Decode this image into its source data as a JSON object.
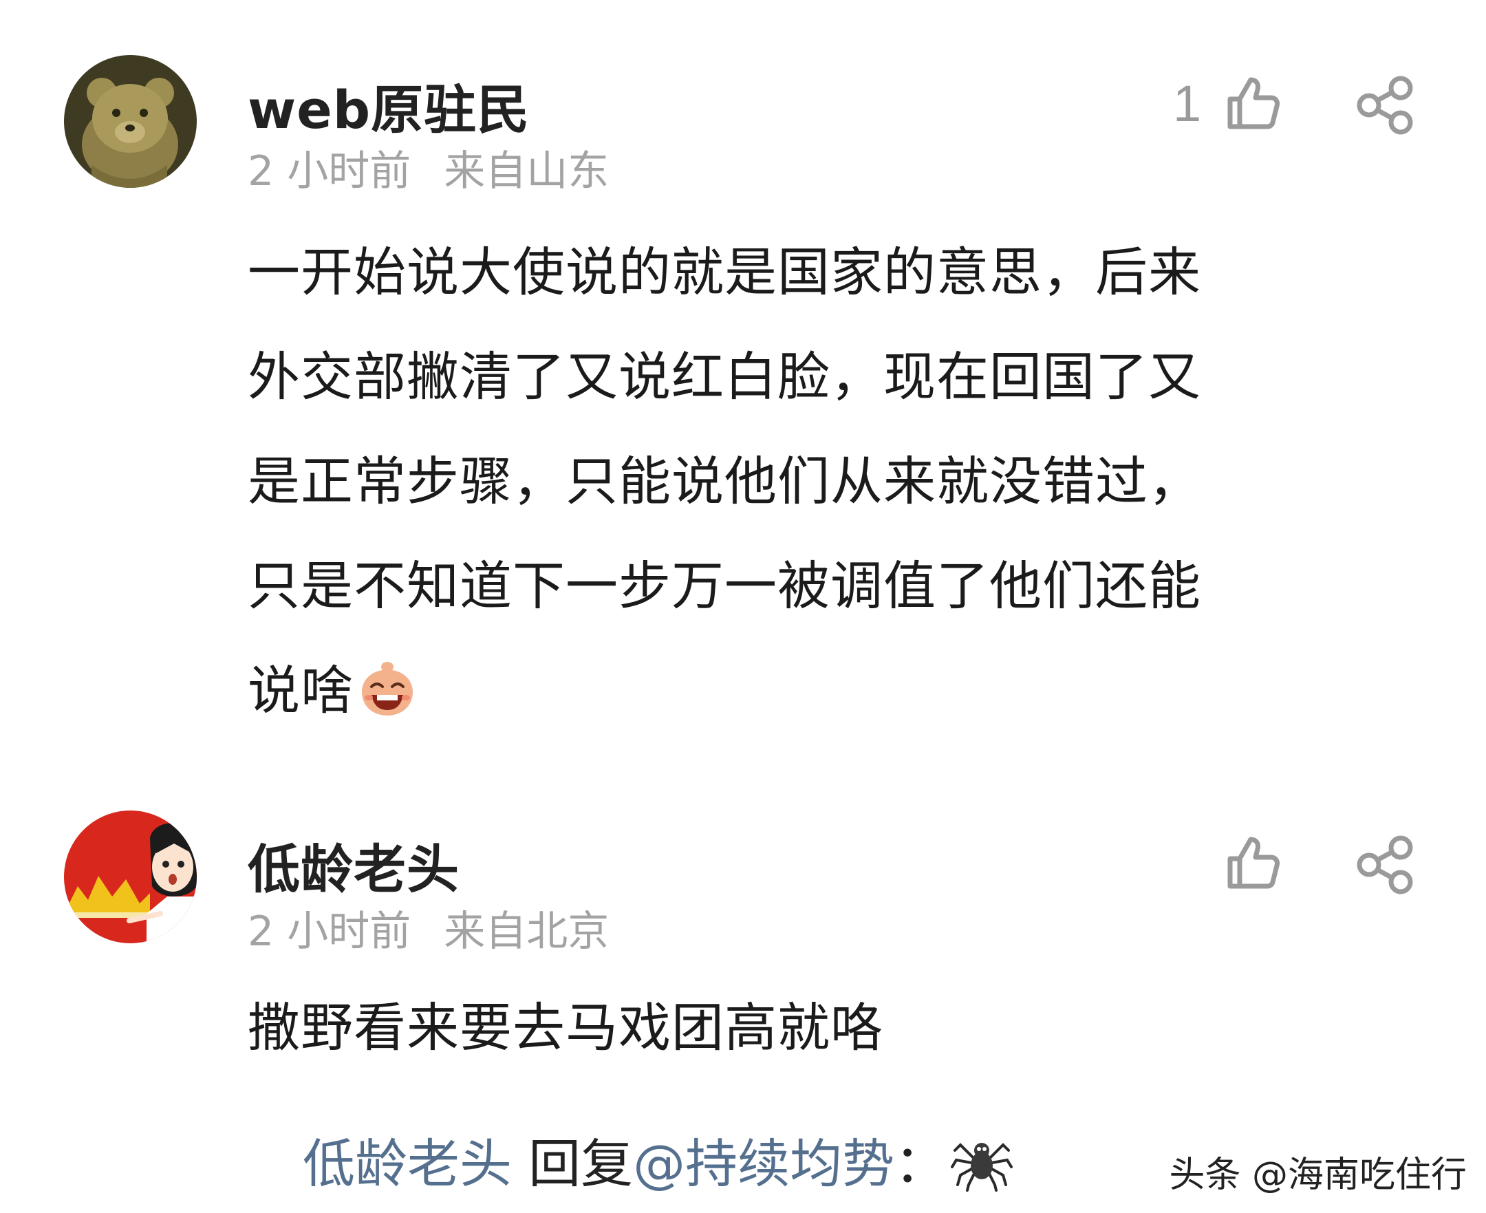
{
  "comments": [
    {
      "username": "web原驻民",
      "time": "2 小时前",
      "location": "来自山东",
      "like_count": "1",
      "text_lines": [
        "一开始说大使说的就是国家的意思，后来",
        "外交部撇清了又说红白脸，现在回国了又",
        "是正常步骤，只能说他们从来就没错过，",
        "只是不知道下一步万一被调值了他们还能",
        "说啥"
      ],
      "trailing_emoji": "grinning-face-emoji",
      "avatar": "teddy-bear-avatar"
    },
    {
      "username": "低龄老头",
      "time": "2 小时前",
      "location": "来自北京",
      "text": "撒野看来要去马戏团高就咯",
      "avatar": "cartoon-boy-avatar"
    }
  ],
  "reply": {
    "name": "低龄老头",
    "verb": " 回复",
    "mention": "@持续均势",
    "colon": "：",
    "emoji": "spider-emoji"
  },
  "watermark": "头条 @海南吃住行",
  "colors": {
    "meta_gray": "#a3a3a3",
    "icon_gray": "#9a9a9a",
    "reply_blue": "#55708f"
  }
}
